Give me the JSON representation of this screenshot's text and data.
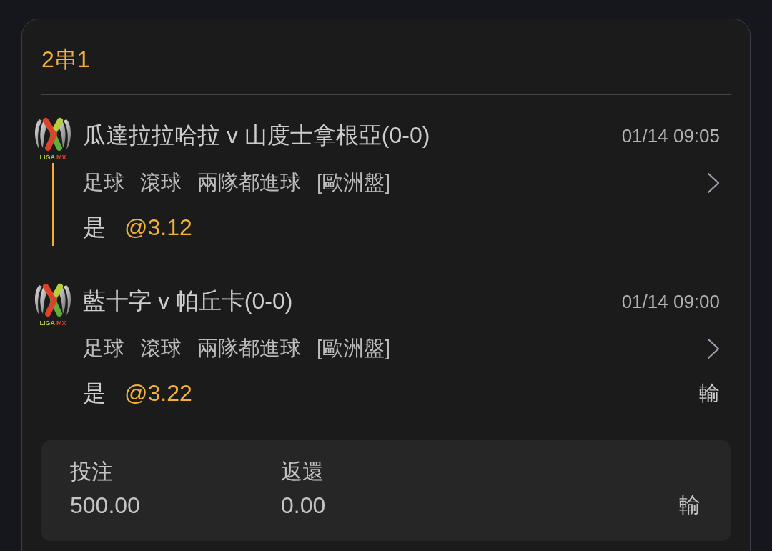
{
  "bet": {
    "title": "2串1"
  },
  "legs": [
    {
      "league": [
        {
          "text": "LIGA",
          "color": "#b9cf3a"
        },
        {
          "text": "MX",
          "color": "#d9432e"
        }
      ],
      "match": "瓜達拉拉哈拉 v 山度士拿根亞(0-0)",
      "time": "01/14 09:05",
      "market": [
        "足球",
        "滾球",
        "兩隊都進球",
        "[歐洲盤]"
      ],
      "pick": "是",
      "odds": "@3.12"
    },
    {
      "league": [
        {
          "text": "LIGA",
          "color": "#b9cf3a"
        },
        {
          "text": "MX",
          "color": "#d9432e"
        }
      ],
      "match": "藍十字 v 帕丘卡(0-0)",
      "time": "01/14 09:00",
      "market": [
        "足球",
        "滾球",
        "兩隊都進球",
        "[歐洲盤]"
      ],
      "pick": "是",
      "odds": "@3.22",
      "result": "輸"
    }
  ],
  "summary": {
    "stake_label": "投注",
    "stake": "500.00",
    "return_label": "返還",
    "return": "0.00",
    "status": "輸"
  }
}
